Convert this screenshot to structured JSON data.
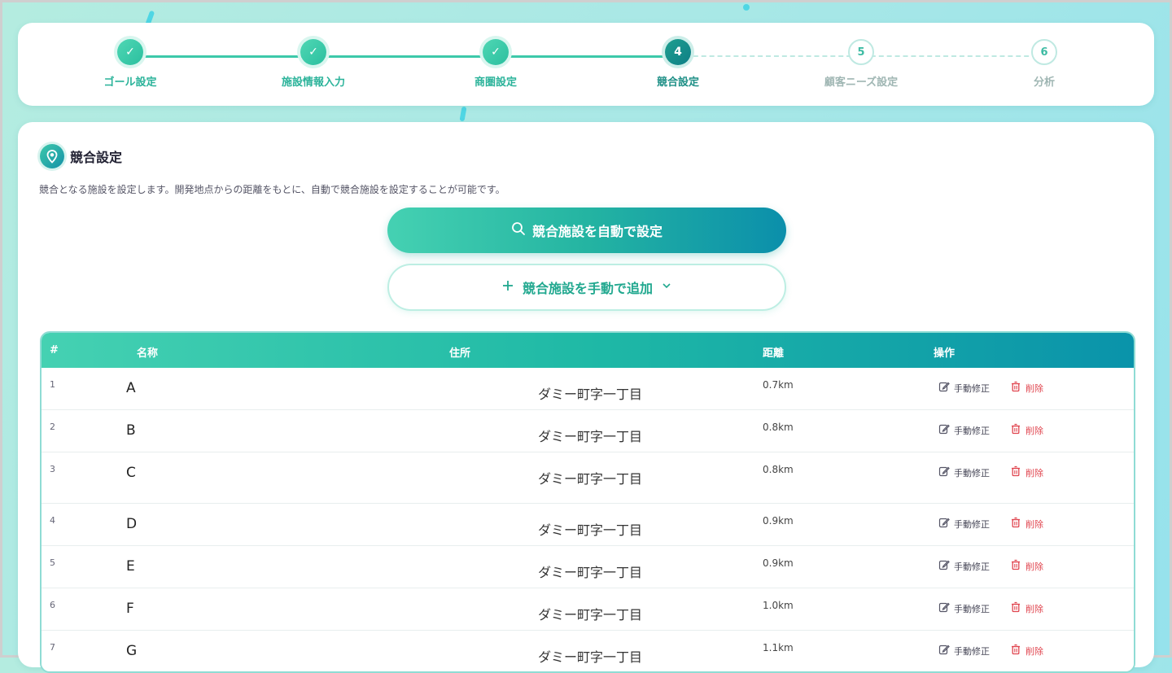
{
  "stepper": {
    "steps": [
      {
        "label": "ゴール設定",
        "mark": "✓",
        "state": "done"
      },
      {
        "label": "施設情報入力",
        "mark": "✓",
        "state": "done"
      },
      {
        "label": "商圏設定",
        "mark": "✓",
        "state": "done"
      },
      {
        "label": "競合設定",
        "mark": "4",
        "state": "current"
      },
      {
        "label": "顧客ニーズ設定",
        "mark": "5",
        "state": "todo"
      },
      {
        "label": "分析",
        "mark": "6",
        "state": "todo"
      }
    ]
  },
  "section": {
    "icon": "location-pin-icon",
    "title": "競合設定",
    "description": "競合となる施設を設定します。開発地点からの距離をもとに、自動で競合施設を設定することが可能です。"
  },
  "actions": {
    "auto_label": "競合施設を自動で設定",
    "manual_label": "競合施設を手動で追加"
  },
  "table": {
    "headers": {
      "no": "#",
      "name": "名称",
      "address": "住所",
      "distance": "距離",
      "ops": "操作"
    },
    "edit_label": "手動修正",
    "delete_label": "削除",
    "rows": [
      {
        "no": "1",
        "name": "A",
        "address": "ダミー町字一丁目",
        "distance": "0.7km"
      },
      {
        "no": "2",
        "name": "B",
        "address": "ダミー町字一丁目",
        "distance": "0.8km"
      },
      {
        "no": "3",
        "name": "C",
        "address": "ダミー町字一丁目",
        "distance": "0.8km"
      },
      {
        "no": "4",
        "name": "D",
        "address": "ダミー町字一丁目",
        "distance": "0.9km"
      },
      {
        "no": "5",
        "name": "E",
        "address": "ダミー町字一丁目",
        "distance": "0.9km"
      },
      {
        "no": "6",
        "name": "F",
        "address": "ダミー町字一丁目",
        "distance": "1.0km"
      },
      {
        "no": "7",
        "name": "G",
        "address": "ダミー町字一丁目",
        "distance": "1.1km"
      }
    ]
  },
  "colors": {
    "accent": "#2bb39a",
    "accent_dark": "#0b8fab",
    "danger": "#e0454f"
  }
}
